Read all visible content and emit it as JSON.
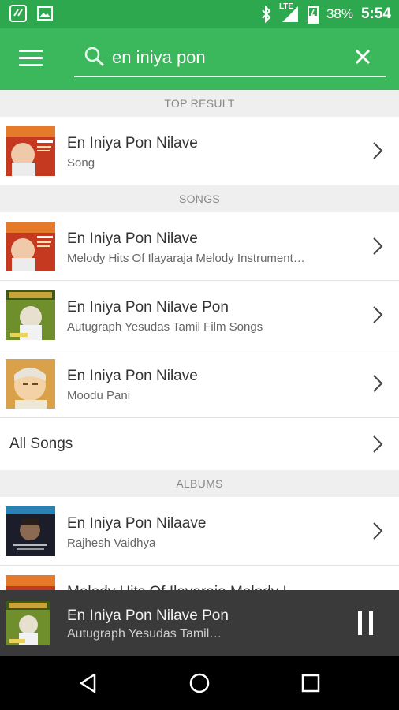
{
  "status_bar": {
    "battery_pct": "38%",
    "time": "5:54",
    "network_label": "LTE",
    "icons": [
      "saavn-app-icon",
      "image-icon",
      "bluetooth-icon",
      "lte-signal-icon",
      "battery-icon"
    ]
  },
  "app_bar": {
    "menu_icon": "hamburger-menu-icon",
    "search": {
      "value": "en iniya pon",
      "icon": "search-icon"
    },
    "clear_icon": "close-icon",
    "colors": {
      "status": "#2ea84f",
      "bar": "#3ab85b"
    }
  },
  "sections": {
    "top_result": {
      "header": "TOP RESULT",
      "items": [
        {
          "title": "En Iniya Pon Nilave",
          "subtitle": "Song"
        }
      ]
    },
    "songs": {
      "header": "SONGS",
      "items": [
        {
          "title": "En Iniya Pon Nilave",
          "subtitle": "Melody Hits Of Ilayaraja Melody Instrument…"
        },
        {
          "title": "En Iniya Pon Nilave Pon",
          "subtitle": "Autugraph Yesudas Tamil Film Songs"
        },
        {
          "title": "En Iniya Pon Nilave",
          "subtitle": "Moodu Pani"
        }
      ],
      "all_label": "All Songs"
    },
    "albums": {
      "header": "ALBUMS",
      "items": [
        {
          "title": "En Iniya Pon Nilaave",
          "subtitle": "Rajhesh Vaidhya"
        },
        {
          "title": "Melody Hits Of Ilayaraja Melody I…",
          "subtitle": ""
        }
      ]
    }
  },
  "now_playing": {
    "title": "En Iniya Pon Nilave Pon",
    "subtitle": "Autugraph Yesudas Tamil…",
    "control_icon": "pause-icon",
    "background": "#3a3a3a"
  },
  "nav_bar": {
    "icons": [
      "back-icon",
      "home-icon",
      "recents-icon"
    ]
  }
}
